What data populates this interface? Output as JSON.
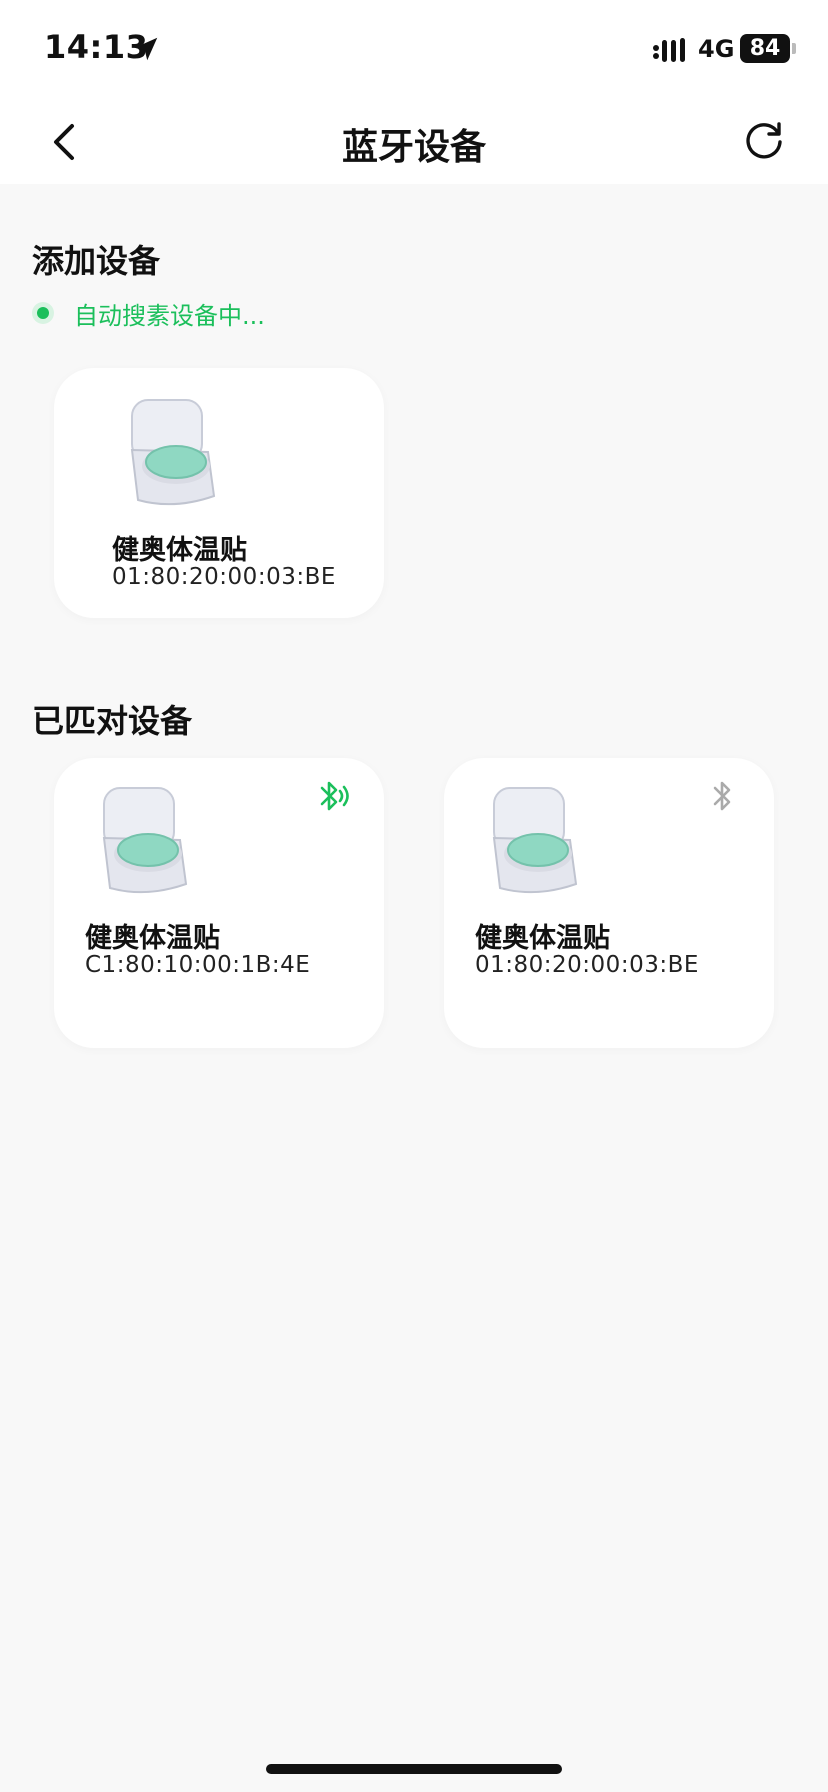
{
  "status_bar": {
    "time": "14:13",
    "network": "4G",
    "battery": "84"
  },
  "nav": {
    "title": "蓝牙设备",
    "back_icon": "chevron-left-icon",
    "refresh_icon": "refresh-icon"
  },
  "add_section": {
    "title": "添加设备",
    "searching_text": "自动搜素设备中...",
    "devices": [
      {
        "name": "健奥体温贴",
        "mac": "01:80:20:00:03:BE"
      }
    ]
  },
  "paired_section": {
    "title": "已匹对设备",
    "devices": [
      {
        "name": "健奥体温贴",
        "mac": "C1:80:10:00:1B:4E",
        "connected": true
      },
      {
        "name": "健奥体温贴",
        "mac": "01:80:20:00:03:BE",
        "connected": false
      }
    ]
  },
  "colors": {
    "accent_green": "#1bbf5b",
    "disconnected_gray": "#aaaaaa",
    "device_teal": "#8fd8c2"
  }
}
